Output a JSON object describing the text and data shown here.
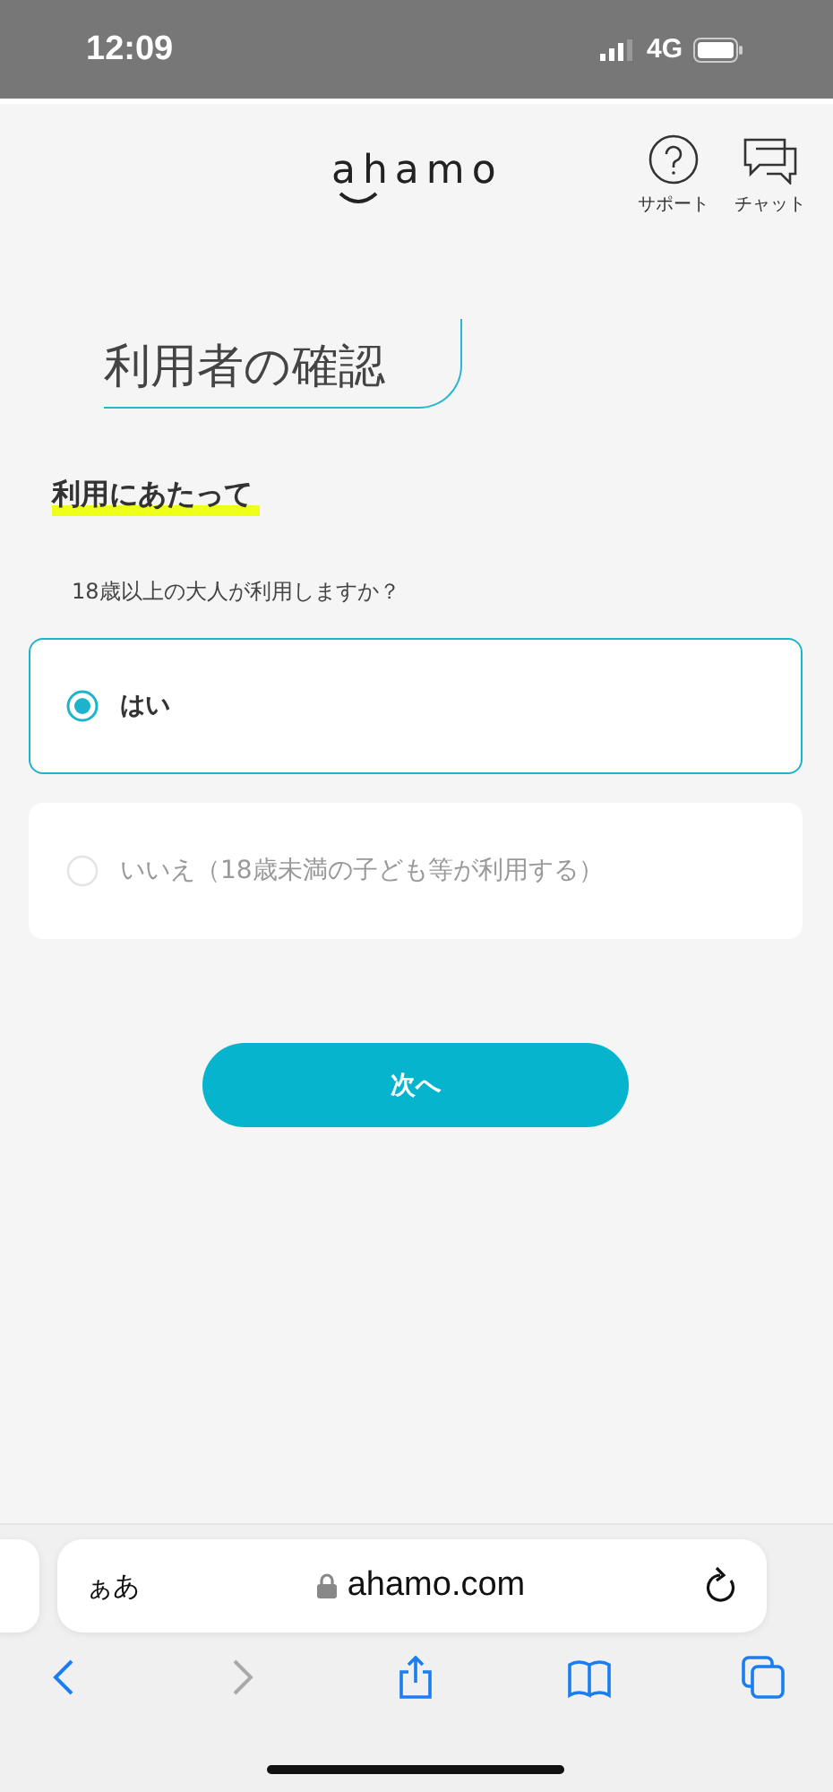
{
  "status_bar": {
    "time": "12:09",
    "network": "4G"
  },
  "header": {
    "logo": "ahamo",
    "actions": [
      {
        "kind": "support",
        "label": "サポート"
      },
      {
        "kind": "chat",
        "label": "チャット"
      }
    ]
  },
  "page_title": "利用者の確認",
  "section_heading": "利用にあたって",
  "question": "18歳以上の大人が利用しますか？",
  "options": [
    {
      "label": "はい",
      "selected": true
    },
    {
      "label": "いいえ（18歳未満の子ども等が利用する）",
      "selected": false
    }
  ],
  "next_button": "次へ",
  "browser": {
    "text_size": "ぁあ",
    "url": "ahamo.com",
    "toolbar": [
      {
        "kind": "back",
        "disabled": false
      },
      {
        "kind": "forward",
        "disabled": true
      },
      {
        "kind": "share",
        "disabled": false
      },
      {
        "kind": "bookmarks",
        "disabled": false
      },
      {
        "kind": "tabs",
        "disabled": false
      }
    ]
  }
}
